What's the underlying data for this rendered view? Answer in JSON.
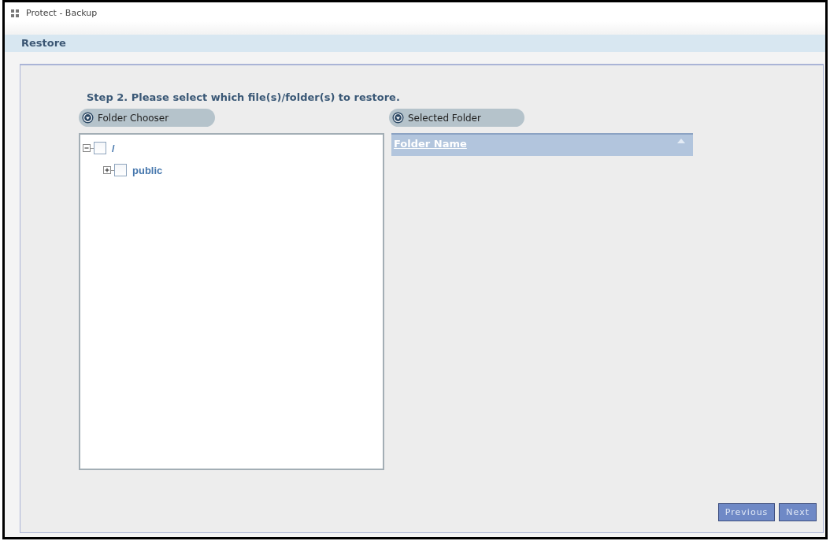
{
  "window": {
    "title": "Protect - Backup"
  },
  "section": {
    "title": "Restore"
  },
  "step": {
    "text": "Step 2. Please select which file(s)/folder(s) to restore."
  },
  "folder_chooser": {
    "label": "Folder Chooser",
    "tree": [
      {
        "label": "/",
        "expanded": true,
        "checked": false,
        "children": [
          {
            "label": "public",
            "expanded": false,
            "checked": false
          }
        ]
      }
    ]
  },
  "selected_folder": {
    "label": "Selected Folder",
    "table": {
      "columns": [
        {
          "label": "Folder Name",
          "sorted_ascending": true
        }
      ]
    }
  },
  "buttons": [
    {
      "label": "Previous"
    },
    {
      "label": "Next"
    }
  ]
}
